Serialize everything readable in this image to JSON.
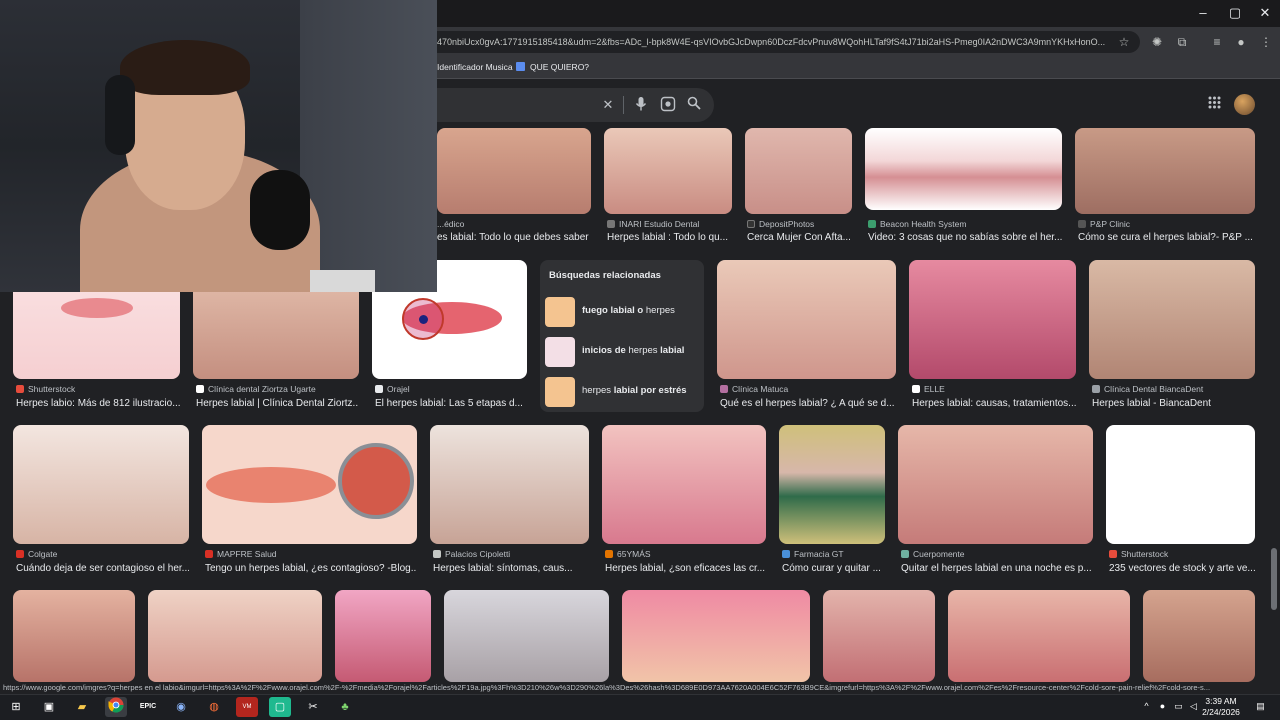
{
  "browser": {
    "url": "470nbiUcx0gvA:1771915185418&udm=2&fbs=ADc_l-bpk8W4E-qsVIOvbGJcDwpn60DczFdcvPnuv8WQohHLTaf9fS4tJ71bi2aHS-Pmeg0IA2nDWC3A9mnYKHxHonO...",
    "bookmarks": [
      "Identificador Musica",
      "QUE QUIERO?"
    ],
    "window_controls": [
      "–",
      "▢",
      "✕"
    ]
  },
  "search": {
    "clear_icon": "✕",
    "mic_icon": "🎤",
    "lens_icon": "⌾",
    "search_icon": "⌕"
  },
  "rows": [
    [
      {
        "source": "...édico",
        "caption": "es labial: Todo lo que debes saber",
        "fav": "#cc3333",
        "skin": [
          "#d8a58e",
          "#b77d6f"
        ]
      },
      {
        "source": "INARI Estudio Dental",
        "caption": "Herpes labial : Todo lo qu...",
        "fav": "#777777",
        "skin": [
          "#eac8b8",
          "#c98c82"
        ]
      },
      {
        "source": "DepositPhotos",
        "caption": "Cerca Mujer Con Afta...",
        "fav": "#333333",
        "skin": [
          "#e0b7ad",
          "#c88f88"
        ]
      },
      {
        "source": "Beacon Health System",
        "caption": "Video: 3 cosas que no sabías sobre el her...",
        "fav": "#3c9e6e",
        "skin": [
          "#ffffff",
          "#d58f93"
        ]
      },
      {
        "source": "P&P Clinic",
        "caption": "Cómo se cura el herpes labial?- P&P ...",
        "fav": "#555555",
        "skin": [
          "#c89a86",
          "#9e6e62"
        ]
      }
    ],
    [
      {
        "source": "Shutterstock",
        "caption": "Herpes labio: Más de 812 ilustracio...",
        "fav": "#e74c3c",
        "skin": [
          "#fbe3e4",
          "#e98a8f"
        ]
      },
      {
        "source": "Clínica dental Ziortza Ugarte",
        "caption": "Herpes labial | Clínica Dental Ziortz...",
        "fav": "#ffffff",
        "skin": [
          "#e7c3b1",
          "#c48f80"
        ]
      },
      {
        "source": "Orajel",
        "caption": "El herpes labial: Las 5 etapas d...",
        "fav": "#e8eaed",
        "skin": [
          "#ffffff",
          "#e5646f"
        ]
      },
      {
        "source": "Clínica Matuca",
        "caption": "Qué es el herpes labial? ¿ A qué se d...",
        "fav": "#b36fa0",
        "skin": [
          "#eac9b8",
          "#cf968c"
        ]
      },
      {
        "source": "ELLE",
        "caption": "Herpes labial: causas, tratamientos...",
        "fav": "#ffffff",
        "skin": [
          "#e68aa0",
          "#b34a6b"
        ]
      },
      {
        "source": "Clínica Dental BiancaDent",
        "caption": "Herpes labial - BiancaDent",
        "fav": "#9aa0a6",
        "skin": [
          "#d9b9a5",
          "#b18574"
        ]
      }
    ],
    [
      {
        "source": "Colgate",
        "caption": "Cuándo deja de ser contagioso el her...",
        "fav": "#d93025",
        "skin": [
          "#f3e6e0",
          "#d7b4a5"
        ]
      },
      {
        "source": "MAPFRE Salud",
        "caption": "Tengo un herpes labial, ¿es contagioso? -Blog...",
        "fav": "#d93025",
        "skin": [
          "#f6d7cb",
          "#e9836f"
        ]
      },
      {
        "source": "Palacios Cipoletti",
        "caption": "Herpes labial: síntomas, caus...",
        "fav": "#c4c7c5",
        "skin": [
          "#ede3dd",
          "#c7a396"
        ]
      },
      {
        "source": "65YMÁS",
        "caption": "Herpes labial, ¿son eficaces las cr...",
        "fav": "#e37400",
        "skin": [
          "#f2c3c0",
          "#d8798e"
        ]
      },
      {
        "source": "Farmacia GT",
        "caption": "Cómo curar y quitar ...",
        "fav": "#4a90d9",
        "skin": [
          "#cfc07a",
          "#2f6b4a"
        ]
      },
      {
        "source": "Cuerpomente",
        "caption": "Quitar el herpes labial en una noche es p...",
        "fav": "#6fb0a0",
        "skin": [
          "#e6b7a9",
          "#c57b79"
        ]
      },
      {
        "source": "Shutterstock",
        "caption": "235 vectores de stock y arte ve...",
        "fav": "#e74c3c",
        "skin": [
          "#ffffff",
          "#e9a2ad"
        ]
      }
    ],
    [
      {
        "skin": [
          "#e4b2a0",
          "#b77369"
        ]
      },
      {
        "skin": [
          "#efd2c5",
          "#d59a8f"
        ]
      },
      {
        "skin": [
          "#f1a6c4",
          "#c55a73"
        ]
      },
      {
        "skin": [
          "#d8d6dc",
          "#a8a1a6"
        ]
      },
      {
        "skin": [
          "#ef8aa3",
          "#f1c4a8"
        ]
      },
      {
        "skin": [
          "#e3b3ab",
          "#c26f74"
        ]
      },
      {
        "skin": [
          "#e8b5a8",
          "#c96f72"
        ]
      },
      {
        "skin": [
          "#d4a38e",
          "#a76d5f"
        ]
      }
    ]
  ],
  "related": {
    "title": "Búsquedas relacionadas",
    "items": [
      {
        "bold": "fuego labial o",
        "normal": " herpes"
      },
      {
        "bold": "inicios de",
        "normal": " herpes ",
        "bold2": "labial"
      },
      {
        "bold": "",
        "normal": "herpes ",
        "bold2": "labial por estrés"
      }
    ]
  },
  "status_url": "https://www.google.com/imgres?q=herpes en el labio&imgurl=https%3A%2F%2Fwww.orajel.com%2F-%2Fmedia%2Forajel%2Farticles%2F19a.jpg%3Fh%3D210%26w%3D290%26la%3Des%26hash%3D689E0D973AA7620A004E6C52F763B9CE&imgrefurl=https%3A%2F%2Fwww.orajel.com%2Fes%2Fresource-center%2Fcold-sore-pain-relief%2Fcold-sore-s...",
  "taskbar": {
    "time": "3:39 AM",
    "date": "2/24/2026"
  }
}
